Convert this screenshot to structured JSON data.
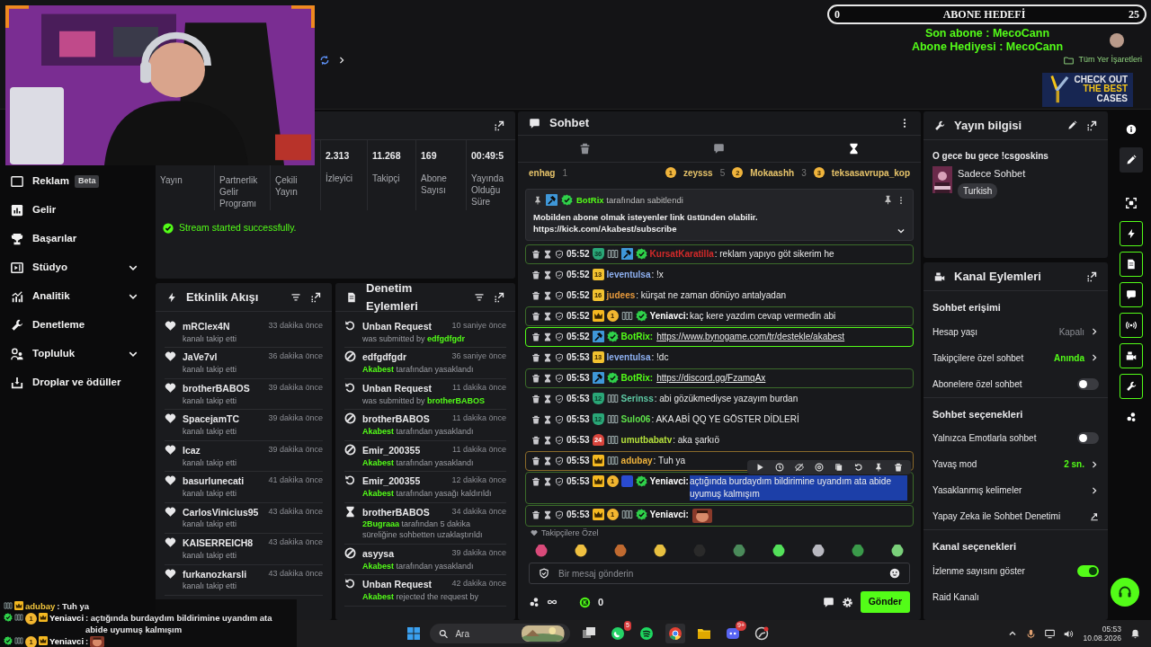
{
  "topbar": {
    "bookmarks": "Tüm Yer İşaretleri",
    "ad": [
      "CHECK OUT",
      "THE BEST",
      "CASES"
    ]
  },
  "goal": {
    "current": "0",
    "title": "ABONE HEDEFİ",
    "target": "25"
  },
  "sub_alerts": [
    "Son abone : MecoCann",
    "Abone Hediyesi : MecoCann"
  ],
  "sidebar": {
    "items": [
      {
        "kind": "ads",
        "label": "Reklam",
        "tag": "Beta",
        "expandable": false
      },
      {
        "kind": "revenue",
        "label": "Gelir",
        "expandable": false
      },
      {
        "kind": "trophy",
        "label": "Başarılar",
        "expandable": false
      },
      {
        "kind": "studio",
        "label": "Stüdyo",
        "expandable": true
      },
      {
        "kind": "analytics",
        "label": "Analitik",
        "expandable": true
      },
      {
        "kind": "wrench",
        "label": "Denetleme",
        "expandable": false
      },
      {
        "kind": "people",
        "label": "Topluluk",
        "expandable": true
      },
      {
        "kind": "drops",
        "label": "Droplar ve ödüller",
        "expandable": false
      }
    ]
  },
  "stats": {
    "columns": [
      {
        "label": "Yayın"
      },
      {
        "label": "Partnerlik Gelir Programı"
      },
      {
        "label": "Çekili Yayın"
      },
      {
        "value": "2.313",
        "label": "İzleyici"
      },
      {
        "value": "11.268",
        "label": "Takipçi"
      },
      {
        "value": "169",
        "label": "Abone Sayısı"
      },
      {
        "value": "00:49:5",
        "label": "Yayında Olduğu Süre"
      }
    ],
    "message": "Stream started successfully."
  },
  "activity": {
    "title": "Etkinlik Akışı",
    "items": [
      {
        "user": "mRClex4N",
        "time": "33 dakika önce",
        "action": "kanalı takip etti"
      },
      {
        "user": "JaVe7vl",
        "time": "36 dakika önce",
        "action": "kanalı takip etti"
      },
      {
        "user": "brotherBABOS",
        "time": "39 dakika önce",
        "action": "kanalı takip etti"
      },
      {
        "user": "SpacejamTC",
        "time": "39 dakika önce",
        "action": "kanalı takip etti"
      },
      {
        "user": "Icaz",
        "time": "39 dakika önce",
        "action": "kanalı takip etti"
      },
      {
        "user": "basurlunecati",
        "time": "41 dakika önce",
        "action": "kanalı takip etti"
      },
      {
        "user": "CarlosVinicius95",
        "time": "43 dakika önce",
        "action": "kanalı takip etti"
      },
      {
        "user": "KAISERREICH8",
        "time": "43 dakika önce",
        "action": "kanalı takip etti"
      },
      {
        "user": "furkanozkarsli",
        "time": "43 dakika önce",
        "action": "kanalı takip etti"
      }
    ]
  },
  "moderation": {
    "title": "Denetim Eylemleri",
    "items": [
      {
        "kind": "unban",
        "title": "Unban Request",
        "time": "10 saniye önce",
        "detail": [
          {
            "kind": "text",
            "text": "was submitted by"
          },
          {
            "kind": "user",
            "text": "edfgdfgdr"
          }
        ]
      },
      {
        "kind": "ban",
        "title": "edfgdfgdr",
        "time": "36 saniye önce",
        "detail": [
          {
            "kind": "user",
            "text": "Akabest"
          },
          {
            "kind": "text",
            "text": "tarafından yasaklandı"
          }
        ]
      },
      {
        "kind": "unban",
        "title": "Unban Request",
        "time": "11 dakika önce",
        "detail": [
          {
            "kind": "text",
            "text": "was submitted by"
          },
          {
            "kind": "user",
            "text": "brotherBABOS"
          }
        ]
      },
      {
        "kind": "ban",
        "title": "brotherBABOS",
        "time": "11 dakika önce",
        "detail": [
          {
            "kind": "user",
            "text": "Akabest"
          },
          {
            "kind": "text",
            "text": "tarafından yasaklandı"
          }
        ]
      },
      {
        "kind": "ban",
        "title": "Emir_200355",
        "time": "11 dakika önce",
        "detail": [
          {
            "kind": "user",
            "text": "Akabest"
          },
          {
            "kind": "text",
            "text": "tarafından yasaklandı"
          }
        ]
      },
      {
        "kind": "unban",
        "title": "Emir_200355",
        "time": "12 dakika önce",
        "detail": [
          {
            "kind": "user",
            "text": "Akabest"
          },
          {
            "kind": "text",
            "text": "tarafından yasağı kaldırıldı"
          }
        ]
      },
      {
        "kind": "timeout",
        "title": "brotherBABOS",
        "time": "34 dakika önce",
        "detail": [
          {
            "kind": "user",
            "text": "2Bugraaa"
          },
          {
            "kind": "text",
            "text": "tarafından 5 dakika süreliğine sohbetten uzaklaştırıldı"
          }
        ]
      },
      {
        "kind": "ban",
        "title": "asyysa",
        "time": "39 dakika önce",
        "detail": [
          {
            "kind": "user",
            "text": "Akabest"
          },
          {
            "kind": "text",
            "text": "tarafından yasaklandı"
          }
        ]
      },
      {
        "kind": "unban",
        "title": "Unban Request",
        "time": "42 dakika önce",
        "detail": [
          {
            "kind": "user",
            "text": "Akabest"
          },
          {
            "kind": "text",
            "text": "rejected the request by"
          }
        ]
      }
    ]
  },
  "chat": {
    "title": "Sohbet",
    "tabs": [
      {
        "kind": "trash",
        "selected": false
      },
      {
        "kind": "chat",
        "selected": false
      },
      {
        "kind": "hourglass",
        "selected": true
      }
    ],
    "leaders": [
      {
        "name": "enhag",
        "score": "1"
      },
      {
        "rank": "1",
        "name": "zeysss",
        "score": "5"
      },
      {
        "rank": "2",
        "name": "Mokaashh",
        "score": "3"
      },
      {
        "rank": "3",
        "name": "teksasavrupa_kop"
      }
    ],
    "pinned": {
      "badges": [
        {
          "kind": "bot"
        },
        {
          "kind": "verified"
        }
      ],
      "user": "BotRix",
      "by": "tarafından sabitlendi",
      "text": "Mobilden abone olmak isteyenler link üstünden olabilir.",
      "link": "https://kick.com/Akabest/subscribe"
    },
    "messages": [
      {
        "time": "05:52",
        "badges": [
          {
            "kind": "sub",
            "text": "36"
          },
          {
            "kind": "rhr"
          },
          {
            "kind": "bot"
          },
          {
            "kind": "verified"
          }
        ],
        "user": "KursatKaratilla",
        "color": "#d42a2a",
        "text": ": reklam yapıyo göt sikerim he",
        "link": false,
        "highlighted": true,
        "outline": {
          "color": "#3b6b2a"
        },
        "selected": false,
        "hovered": false
      },
      {
        "time": "05:52",
        "badges": [
          {
            "kind": "gold",
            "text": "13"
          }
        ],
        "user": "leventulsa",
        "color": "#8eb0f0",
        "text": ": !x",
        "link": false,
        "highlighted": false,
        "selected": false,
        "hovered": false
      },
      {
        "time": "05:52",
        "badges": [
          {
            "kind": "gold",
            "text": "16"
          }
        ],
        "user": "judees",
        "color": "#e89a3c",
        "text": ": kürşat ne zaman dönüyo antalyadan",
        "link": false,
        "highlighted": false,
        "selected": false,
        "hovered": false
      },
      {
        "time": "05:52",
        "badges": [
          {
            "kind": "crown"
          },
          {
            "kind": "gifter",
            "text": "1"
          },
          {
            "kind": "rhr"
          },
          {
            "kind": "verified"
          }
        ],
        "user": "Yeniavci:",
        "color": "#ffffff",
        "text": "kaç kere yazdım cevap vermedin abi",
        "link": false,
        "highlighted": true,
        "outline": {
          "color": "#3b6b2a"
        },
        "selected": false,
        "hovered": false
      },
      {
        "time": "05:52",
        "badges": [
          {
            "kind": "bot"
          },
          {
            "kind": "verified"
          }
        ],
        "user": "BotRix:",
        "color": "#53fc18",
        "text": "https://www.bynogame.com/tr/destekle/akabest",
        "link": true,
        "highlighted": true,
        "outline": {
          "color": "#53fc18"
        },
        "selected": false,
        "hovered": false
      },
      {
        "time": "05:53",
        "badges": [
          {
            "kind": "gold",
            "text": "13"
          }
        ],
        "user": "leventulsa",
        "color": "#8eb0f0",
        "text": ": !dc",
        "link": false,
        "highlighted": false,
        "selected": false,
        "hovered": false
      },
      {
        "time": "05:53",
        "badges": [
          {
            "kind": "bot"
          },
          {
            "kind": "verified"
          }
        ],
        "user": "BotRix:",
        "color": "#53fc18",
        "text": "https://discord.gg/FzamqAx",
        "link": true,
        "highlighted": true,
        "outline": {
          "color": "#3b6b2a"
        },
        "selected": false,
        "hovered": false
      },
      {
        "time": "05:53",
        "badges": [
          {
            "kind": "sub",
            "text": "12"
          },
          {
            "kind": "rhr"
          }
        ],
        "user": "Serinss",
        "color": "#5ec9a4",
        "text": ": abi gözükmediyse yazayım burdan",
        "link": false,
        "highlighted": false,
        "selected": false,
        "hovered": false
      },
      {
        "time": "05:53",
        "badges": [
          {
            "kind": "sub",
            "text": "12"
          },
          {
            "kind": "rhr"
          }
        ],
        "user": "Sulo06",
        "color": "#5ee04a",
        "text": ": AKA ABİ QQ YE GÖSTER DİDLERİ",
        "link": false,
        "highlighted": false,
        "selected": false,
        "hovered": false
      },
      {
        "time": "05:53",
        "badges": [
          {
            "kind": "red",
            "text": "24"
          },
          {
            "kind": "rhr"
          }
        ],
        "user": "umutbabatv",
        "color": "#b6e23c",
        "text": ": aka şarkıö",
        "link": false,
        "highlighted": false,
        "selected": false,
        "hovered": false
      },
      {
        "time": "05:53",
        "badges": [
          {
            "kind": "crown"
          },
          {
            "kind": "rhr"
          }
        ],
        "user": "adubay",
        "color": "#f0b43c",
        "text": ": Tuh ya",
        "link": false,
        "highlighted": true,
        "outline": {
          "color": "#8a6a2a"
        },
        "selected": false,
        "hovered": true
      },
      {
        "time": "05:53",
        "badges": [
          {
            "kind": "crown"
          },
          {
            "kind": "gifter",
            "text": "1"
          },
          {
            "kind": "blue"
          },
          {
            "kind": "verified"
          }
        ],
        "user": "Yeniavci:",
        "color": "#ffffff",
        "text": "açtığında burdaydım bildirimine uyandım ata abide uyumuş kalmışım",
        "link": false,
        "highlighted": true,
        "outline": {
          "color": "#3b6b2a"
        },
        "selected": true,
        "hovered": false
      },
      {
        "time": "05:53",
        "badges": [
          {
            "kind": "crown"
          },
          {
            "kind": "gifter",
            "text": "1"
          },
          {
            "kind": "rhr"
          },
          {
            "kind": "verified"
          }
        ],
        "user": "Yeniavci:",
        "color": "#ffffff",
        "emote": true,
        "highlighted": true,
        "outline": {
          "color": "#3b6b2a"
        },
        "selected": false,
        "hovered": false
      }
    ],
    "emote_section": "Takipçilere Özel",
    "input": {
      "placeholder": "Bir mesaj gönderin"
    },
    "coins": "0",
    "send": "Gönder"
  },
  "stream_info": {
    "title": "Yayın bilgisi",
    "stream_title": "O gece bu gece !csgoskins",
    "category": "Sadece Sohbet",
    "tag": "Turkish"
  },
  "channel_actions": {
    "title": "Kanal Eylemleri",
    "sections": [
      {
        "title": "Sohbet erişimi",
        "rows": [
          {
            "kind": "value",
            "label": "Hesap yaşı",
            "value": "Kapalı",
            "active": false
          },
          {
            "kind": "value",
            "label": "Takipçilere özel sohbet",
            "value": "Anında",
            "active": true
          },
          {
            "kind": "toggle",
            "label": "Abonelere özel sohbet",
            "on": false
          }
        ]
      },
      {
        "title": "Sohbet seçenekleri",
        "rows": [
          {
            "kind": "toggle",
            "label": "Yalnızca Emotlarla sohbet",
            "on": false
          },
          {
            "kind": "value",
            "label": "Yavaş mod",
            "value": "2 sn.",
            "active": true
          },
          {
            "kind": "link",
            "label": "Yasaklanmış kelimeler"
          },
          {
            "kind": "external",
            "label": "Yapay Zeka ile Sohbet Denetimi"
          }
        ]
      },
      {
        "title": "Kanal seçenekleri",
        "rows": [
          {
            "kind": "toggle",
            "label": "İzlenme sayısını göster",
            "on": true
          },
          {
            "kind": "plain",
            "label": "Raid Kanalı"
          }
        ]
      }
    ]
  },
  "rail": [
    {
      "kind": "info",
      "active": false,
      "selected": false
    },
    {
      "kind": "edit",
      "active": false,
      "selected": true
    },
    {
      "kind": "capture",
      "active": false,
      "selected": false
    },
    {
      "kind": "events",
      "active": true,
      "selected": false
    },
    {
      "kind": "log",
      "active": true,
      "selected": false
    },
    {
      "kind": "chat",
      "active": true,
      "selected": false
    },
    {
      "kind": "broadcast",
      "active": true,
      "selected": false
    },
    {
      "kind": "camera",
      "active": true,
      "selected": false
    },
    {
      "kind": "tools",
      "active": true,
      "selected": false
    },
    {
      "kind": "community",
      "active": false,
      "selected": false
    }
  ],
  "overlay_chat": [
    {
      "badges": [
        {
          "kind": "rhr"
        },
        {
          "kind": "crown"
        }
      ],
      "user": "adubay",
      "color": "#f0c43c",
      "text": ": Tuh ya"
    },
    {
      "badges": [
        {
          "kind": "verified"
        },
        {
          "kind": "rhr"
        },
        {
          "kind": "gifter",
          "text": "1"
        },
        {
          "kind": "crown"
        }
      ],
      "user": "Yeniavci",
      "color": "#ffffff",
      "text": ": açtığında burdaydım bildirimine uyandım ata abide uyumuş kalmışım"
    },
    {
      "badges": [
        {
          "kind": "verified"
        },
        {
          "kind": "rhr"
        },
        {
          "kind": "gifter",
          "text": "1"
        },
        {
          "kind": "crown"
        }
      ],
      "user": "Yeniavci",
      "color": "#ffffff",
      "text": ":",
      "emote": true
    }
  ],
  "taskbar": {
    "search": {
      "placeholder": "Ara"
    },
    "apps": [
      {
        "kind": "taskview",
        "active": false
      },
      {
        "kind": "whatsapp",
        "badge": "5",
        "active": false
      },
      {
        "kind": "spotify",
        "active": false
      },
      {
        "kind": "chrome",
        "active": true
      },
      {
        "kind": "files",
        "active": false
      },
      {
        "kind": "discord",
        "badge": "9+",
        "active": false
      },
      {
        "kind": "app",
        "active": false
      }
    ],
    "time": "05:53",
    "date": "10.08.2026"
  }
}
